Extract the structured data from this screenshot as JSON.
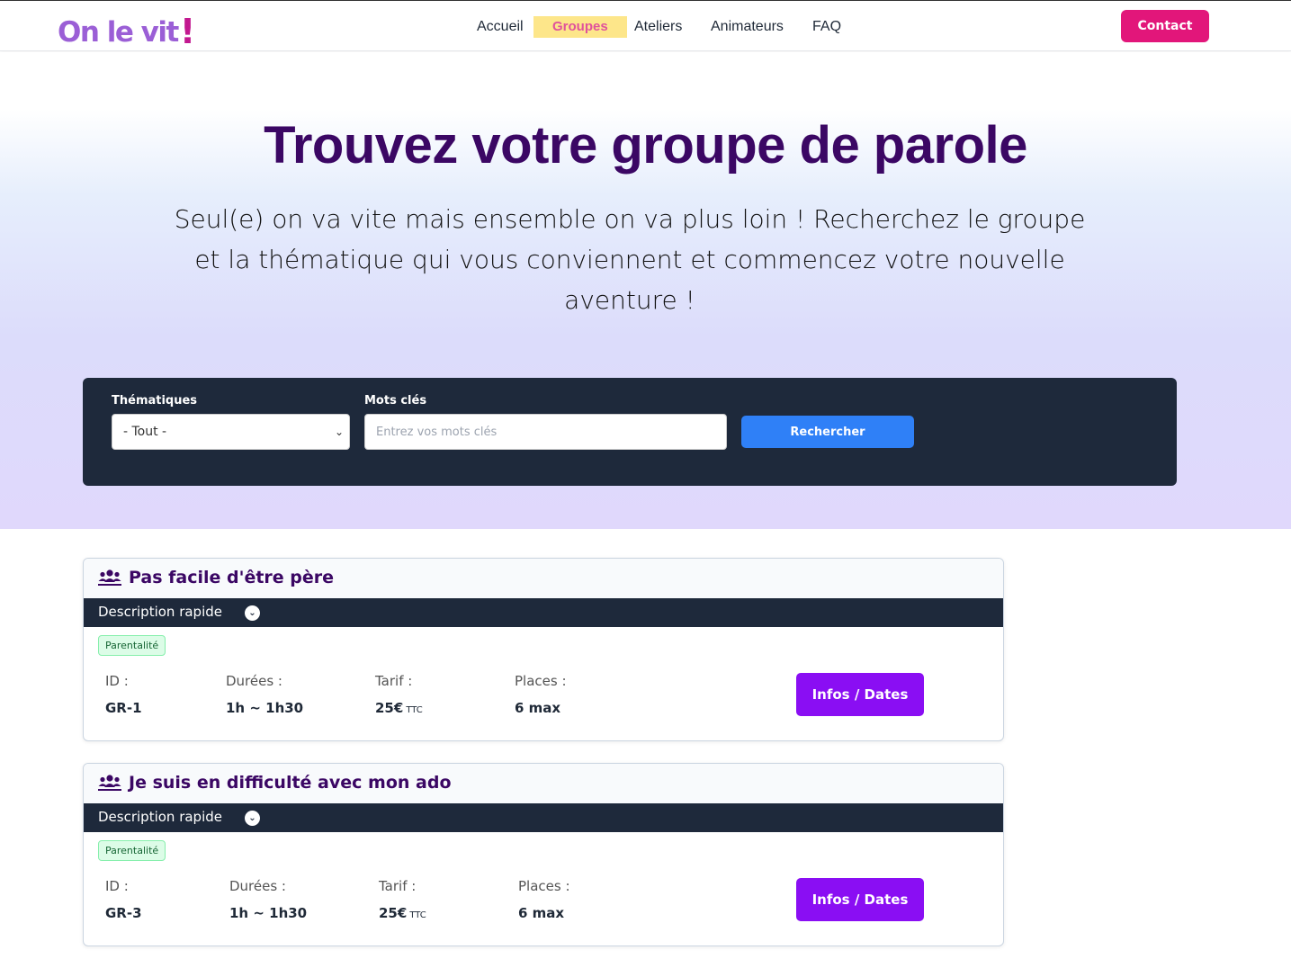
{
  "header": {
    "logo_text": "On le vit",
    "logo_bang": "!",
    "nav": [
      "Accueil",
      "Groupes",
      "Ateliers",
      "Animateurs",
      "FAQ"
    ],
    "active_nav": "Groupes",
    "contact_label": "Contact"
  },
  "hero": {
    "title": "Trouvez votre groupe de parole",
    "subtitle": "Seul(e) on va vite mais ensemble on va plus loin ! Recherchez le groupe et la thématique qui vous conviennent et commencez votre nouvelle aventure !"
  },
  "search": {
    "themes_label": "Thématiques",
    "themes_value": "- Tout -",
    "keywords_label": "Mots clés",
    "keywords_placeholder": "Entrez vos mots clés",
    "keywords_value": "",
    "button_label": "Rechercher"
  },
  "colors": {
    "accent_purple": "#8a0ef3",
    "contact_pink": "#e2167a",
    "search_blue": "#2f80f7",
    "panel_dark": "#1e293b",
    "title_purple": "#3b0764"
  },
  "groups": [
    {
      "title": "Pas facile d'être père",
      "desc_label": "Description rapide",
      "tag": "Parentalité",
      "id_label": "ID :",
      "id_value": "GR-1",
      "duree_label": "Durées :",
      "duree_value": "1h ~ 1h30",
      "tarif_label": "Tarif :",
      "tarif_value": "25€",
      "tarif_suffix": "TTC",
      "places_label": "Places :",
      "places_value": "6 max",
      "button_label": "Infos / Dates"
    },
    {
      "title": "Je suis en difficulté avec mon ado",
      "desc_label": "Description rapide",
      "tag": "Parentalité",
      "id_label": "ID :",
      "id_value": "GR-3",
      "duree_label": "Durées :",
      "duree_value": "1h ~ 1h30",
      "tarif_label": "Tarif :",
      "tarif_value": "25€",
      "tarif_suffix": "TTC",
      "places_label": "Places :",
      "places_value": "6 max",
      "button_label": "Infos / Dates"
    }
  ]
}
